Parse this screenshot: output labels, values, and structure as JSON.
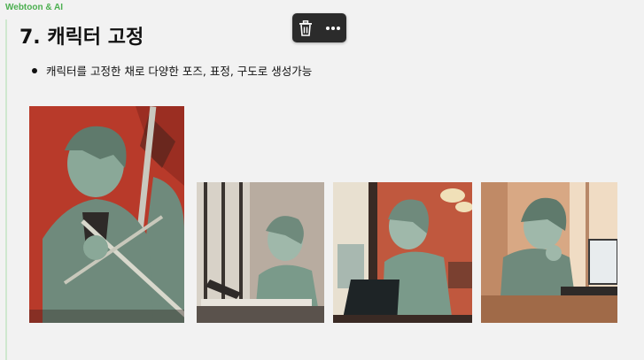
{
  "header": {
    "brand": "Webtoon & AI"
  },
  "slide": {
    "title": "7. 캐릭터 고정",
    "bullets": [
      "캐릭터를 고정한 채로 다양한 포즈, 표정, 구도로 생성가능"
    ]
  },
  "toolbar": {
    "items": [
      {
        "icon": "trash-icon"
      },
      {
        "icon": "more-horizontal-icon"
      }
    ]
  },
  "images": [
    {
      "icon": "character-image"
    },
    {
      "icon": "character-image"
    },
    {
      "icon": "character-image"
    },
    {
      "icon": "character-image"
    }
  ],
  "colors": {
    "brand": "#4caf50",
    "toolbar_bg": "#2b2b2b",
    "background": "#f2f2f2",
    "character_teal": "#7a9a8a",
    "red_bg": "#b83a2a"
  }
}
